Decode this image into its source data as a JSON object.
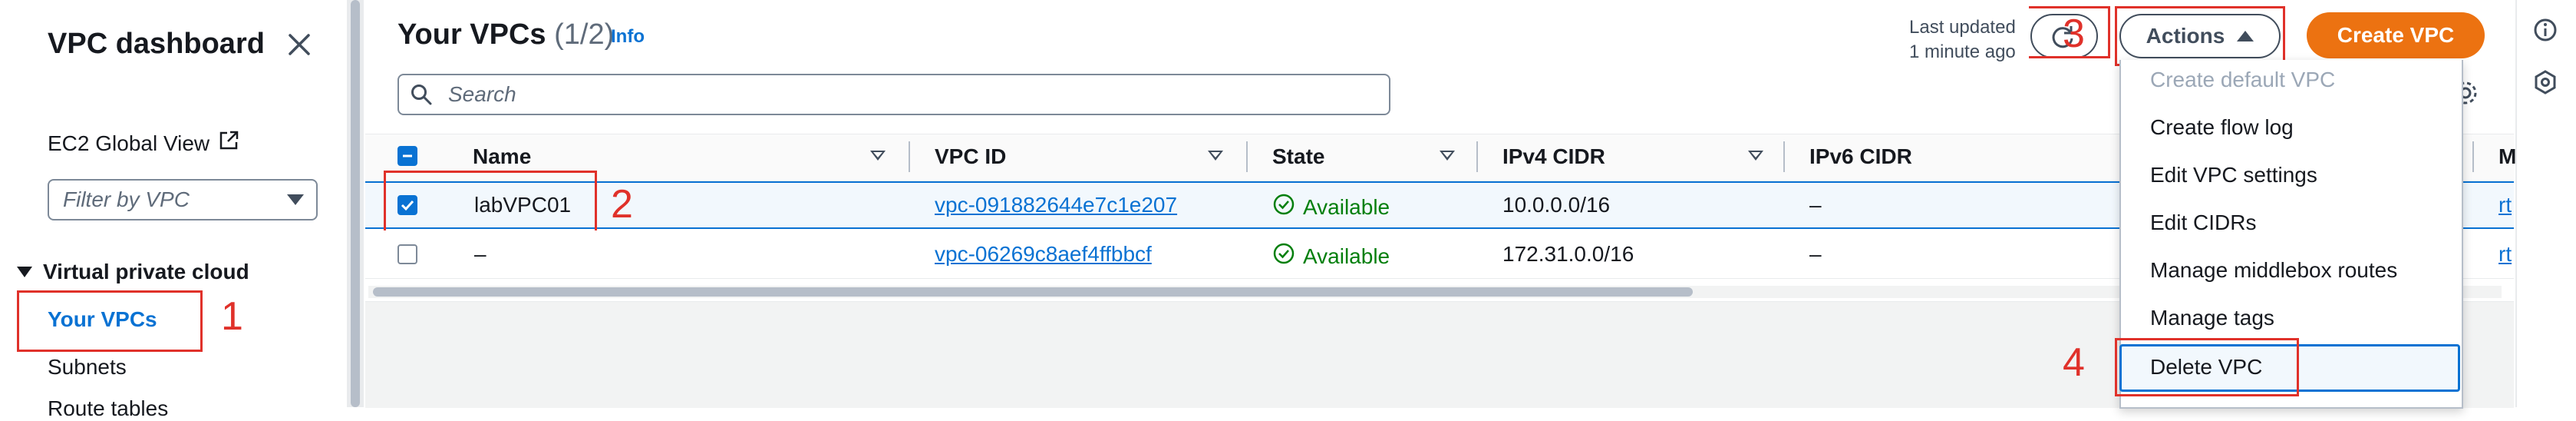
{
  "sidebar": {
    "title": "VPC dashboard",
    "global_view": "EC2 Global View",
    "filter_placeholder": "Filter by VPC",
    "section": "Virtual private cloud",
    "items": [
      "Your VPCs",
      "Subnets",
      "Route tables"
    ]
  },
  "header": {
    "title": "Your VPCs",
    "count": "(1/2)",
    "info": "Info",
    "last_updated_line1": "Last updated",
    "last_updated_line2": "1 minute ago",
    "actions_label": "Actions",
    "create_label": "Create VPC",
    "search_placeholder": "Search"
  },
  "table": {
    "columns": [
      "Name",
      "VPC ID",
      "State",
      "IPv4 CIDR",
      "IPv6 CIDR",
      "M"
    ],
    "rows": [
      {
        "name": "labVPC01",
        "vpc_id": "vpc-091882644e7c1e207",
        "state": "Available",
        "ipv4": "10.0.0.0/16",
        "ipv6": "–",
        "extra": "rt",
        "selected": true
      },
      {
        "name": "–",
        "vpc_id": "vpc-06269c8aef4ffbbcf",
        "state": "Available",
        "ipv4": "172.31.0.0/16",
        "ipv6": "–",
        "extra": "rt",
        "selected": false
      }
    ]
  },
  "actions_menu": {
    "items": [
      "Create default VPC",
      "Create flow log",
      "Edit VPC settings",
      "Edit CIDRs",
      "Manage middlebox routes",
      "Manage tags",
      "Delete VPC"
    ]
  },
  "annotations": [
    "1",
    "2",
    "3",
    "4"
  ],
  "colors": {
    "accent": "#0972d3",
    "create": "#ec7211",
    "success": "#037f0c",
    "annotation": "#e0312a"
  }
}
